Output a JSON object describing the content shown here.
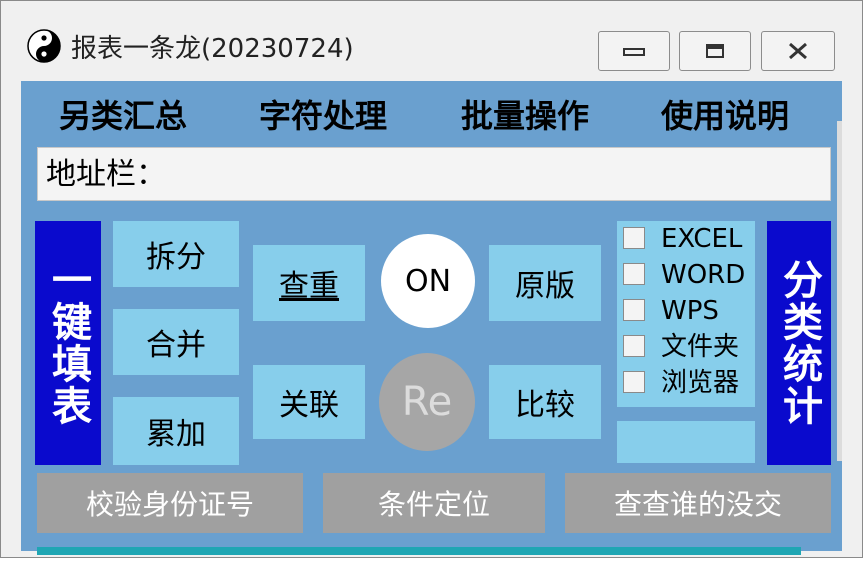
{
  "window": {
    "title": "报表一条龙(20230724)",
    "icon": "yin-yang-icon",
    "controls": [
      "minimize-icon",
      "maximize-icon",
      "close-icon"
    ]
  },
  "menu": [
    {
      "label": "另类汇总"
    },
    {
      "label": "字符处理"
    },
    {
      "label": "批量操作"
    },
    {
      "label": "使用说明"
    }
  ],
  "address": {
    "label": "地址栏：",
    "value": ""
  },
  "left_panel": {
    "label": "一键填表"
  },
  "right_panel": {
    "label": "分类统计"
  },
  "buttons": {
    "split": "拆分",
    "merge": "合并",
    "accumulate": "累加",
    "dedupe": "查重",
    "link": "关联",
    "on": "ON",
    "re": "Re",
    "original": "原版",
    "compare": "比较"
  },
  "checkboxes": [
    {
      "label": "EXCEL",
      "checked": false
    },
    {
      "label": "WORD",
      "checked": false
    },
    {
      "label": "WPS",
      "checked": false
    },
    {
      "label": "文件夹",
      "checked": false
    },
    {
      "label": "浏览器",
      "checked": false
    }
  ],
  "bottom_buttons": {
    "verify_id": "校验身份证号",
    "locate": "条件定位",
    "who_not_submitted": "查查谁的没交"
  },
  "colors": {
    "client_bg": "#6aa0cf",
    "light_button": "#87ceeb",
    "dark_blue": "#0a0acd",
    "gray_button": "#a0a0a0",
    "on_circle": "#ffffff",
    "re_circle": "#a6a6a6"
  }
}
